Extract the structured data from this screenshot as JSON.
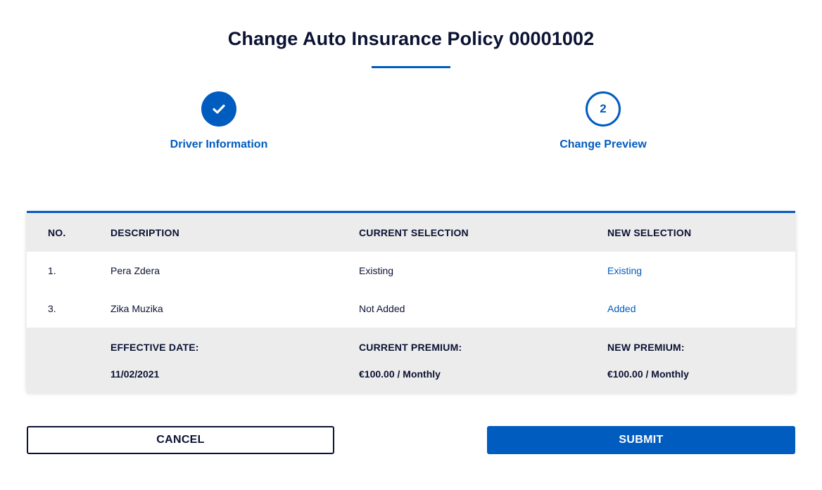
{
  "page": {
    "title": "Change Auto Insurance Policy 00001002"
  },
  "steps": [
    {
      "number": "",
      "label": "Driver Information",
      "status": "completed",
      "icon": "check-icon"
    },
    {
      "number": "2",
      "label": "Change Preview",
      "status": "active"
    }
  ],
  "table": {
    "headers": {
      "no": "NO.",
      "description": "DESCRIPTION",
      "current": "CURRENT SELECTION",
      "new": "NEW SELECTION"
    },
    "rows": [
      {
        "no": "1.",
        "description": "Pera Zdera",
        "current": "Existing",
        "new": "Existing"
      },
      {
        "no": "3.",
        "description": "Zika Muzika",
        "current": "Not Added",
        "new": "Added"
      }
    ],
    "summary": {
      "effective_date_label": "EFFECTIVE DATE:",
      "effective_date": "11/02/2021",
      "current_premium_label": "CURRENT PREMIUM:",
      "current_premium": "€100.00 / Monthly",
      "new_premium_label": "NEW PREMIUM:",
      "new_premium": "€100.00 / Monthly"
    }
  },
  "actions": {
    "cancel_label": "CANCEL",
    "submit_label": "SUBMIT"
  },
  "colors": {
    "accent": "#005cbf",
    "text": "#0b1233",
    "row_gray": "#ececec"
  }
}
